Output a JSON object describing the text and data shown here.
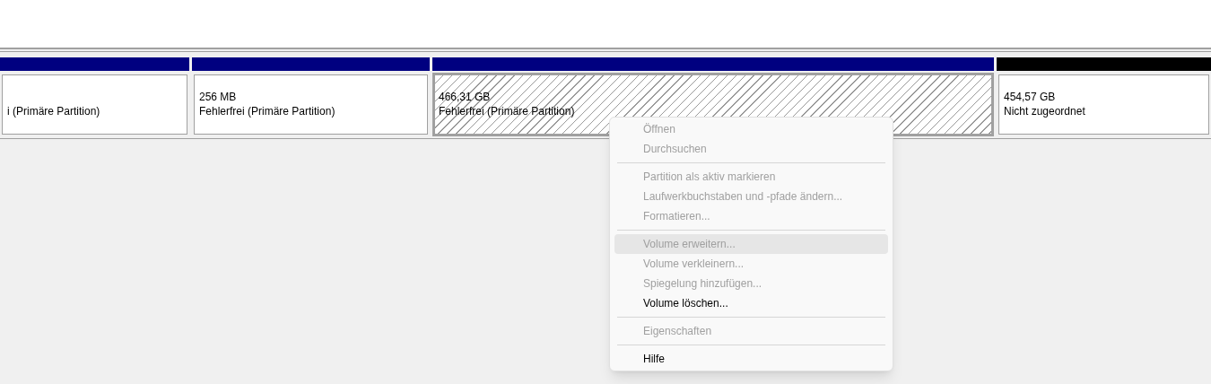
{
  "partitions": [
    {
      "status": "i (Primäre Partition)",
      "color": "#000080",
      "selected": false
    },
    {
      "size": "256 MB",
      "status": "Fehlerfrei (Primäre Partition)",
      "color": "#000080",
      "selected": false
    },
    {
      "size": "466,31 GB",
      "status": "Fehlerfrei (Primäre Partition)",
      "color": "#000080",
      "selected": true
    },
    {
      "size": "454,57 GB",
      "status": "Nicht zugeordnet",
      "color": "#000000",
      "selected": false
    }
  ],
  "context_menu": {
    "items": [
      {
        "kind": "item",
        "label": "Öffnen",
        "disabled": true,
        "selected": false
      },
      {
        "kind": "item",
        "label": "Durchsuchen",
        "disabled": true,
        "selected": false
      },
      {
        "kind": "separator"
      },
      {
        "kind": "item",
        "label": "Partition als aktiv markieren",
        "disabled": true,
        "selected": false
      },
      {
        "kind": "item",
        "label": "Laufwerkbuchstaben und -pfade ändern...",
        "disabled": true,
        "selected": false
      },
      {
        "kind": "item",
        "label": "Formatieren...",
        "disabled": true,
        "selected": false
      },
      {
        "kind": "separator"
      },
      {
        "kind": "item",
        "label": "Volume erweitern...",
        "disabled": true,
        "selected": true
      },
      {
        "kind": "item",
        "label": "Volume verkleinern...",
        "disabled": true,
        "selected": false
      },
      {
        "kind": "item",
        "label": "Spiegelung hinzufügen...",
        "disabled": true,
        "selected": false
      },
      {
        "kind": "item",
        "label": "Volume löschen...",
        "disabled": false,
        "selected": false
      },
      {
        "kind": "separator"
      },
      {
        "kind": "item",
        "label": "Eigenschaften",
        "disabled": true,
        "selected": false
      },
      {
        "kind": "separator"
      },
      {
        "kind": "item",
        "label": "Hilfe",
        "disabled": false,
        "selected": false
      }
    ]
  }
}
